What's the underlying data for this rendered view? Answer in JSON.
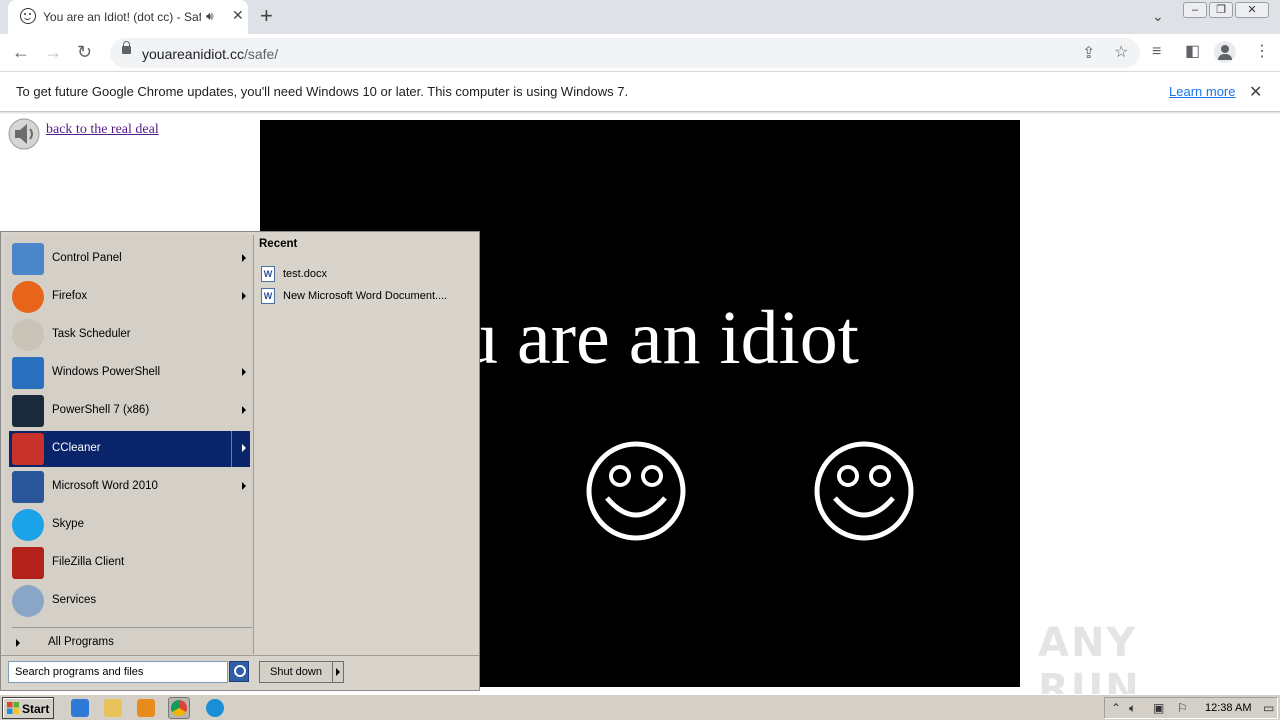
{
  "browser": {
    "tab_title": "You are an Idiot! (dot cc) - Safe",
    "address_host": "youareanidiot.cc",
    "address_path": "/safe/",
    "infobar_message": "To get future Google Chrome updates, you'll need Windows 10 or later. This computer is using Windows 7.",
    "infobar_link": "Learn more"
  },
  "page": {
    "back_link": "back to the real deal",
    "movie_text": "u are an idiot"
  },
  "start_menu": {
    "programs": [
      {
        "label": "Control Panel",
        "icon": "control-panel-icon",
        "submenu": true
      },
      {
        "label": "Firefox",
        "icon": "firefox-icon",
        "submenu": true
      },
      {
        "label": "Task Scheduler",
        "icon": "task-scheduler-icon",
        "submenu": false
      },
      {
        "label": "Windows PowerShell",
        "icon": "powershell-icon",
        "submenu": true
      },
      {
        "label": "PowerShell 7 (x86)",
        "icon": "powershell7-icon",
        "submenu": true
      },
      {
        "label": "CCleaner",
        "icon": "ccleaner-icon",
        "submenu": true,
        "selected": true
      },
      {
        "label": "Microsoft Word 2010",
        "icon": "word-icon",
        "submenu": true
      },
      {
        "label": "Skype",
        "icon": "skype-icon",
        "submenu": false
      },
      {
        "label": "FileZilla Client",
        "icon": "filezilla-icon",
        "submenu": false
      },
      {
        "label": "Services",
        "icon": "services-icon",
        "submenu": false
      }
    ],
    "all_programs": "All Programs",
    "recent_title": "Recent",
    "recent_items": [
      {
        "label": "test.docx"
      },
      {
        "label": "New Microsoft Word Document...."
      }
    ],
    "search_placeholder": "Search programs and files",
    "shutdown_label": "Shut down"
  },
  "taskbar": {
    "start_label": "Start",
    "clock": "12:38 AM"
  },
  "watermark": "ANY RUN"
}
